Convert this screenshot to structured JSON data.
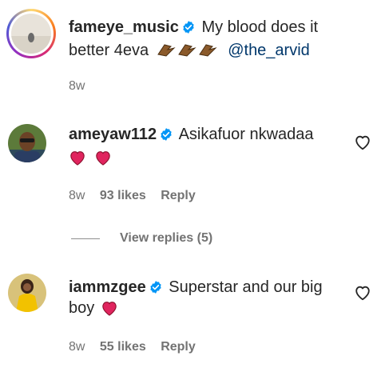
{
  "caption": {
    "username": "fameye_music",
    "text": "My blood does it",
    "text2": "better 4eva",
    "mention": "@the_arvid",
    "time": "8w"
  },
  "comments": [
    {
      "username": "ameyaw112",
      "text": "Asikafuor nkwadaa",
      "time": "8w",
      "likes": "93 likes",
      "reply": "Reply"
    },
    {
      "username": "iammzgee",
      "text": "Superstar and our big",
      "text2": "boy",
      "time": "8w",
      "likes": "55 likes",
      "reply": "Reply"
    }
  ],
  "view_replies": "View replies (5)",
  "colors": {
    "accent": "#0095f6",
    "heart": "#e0245e",
    "mention": "#00376b"
  }
}
